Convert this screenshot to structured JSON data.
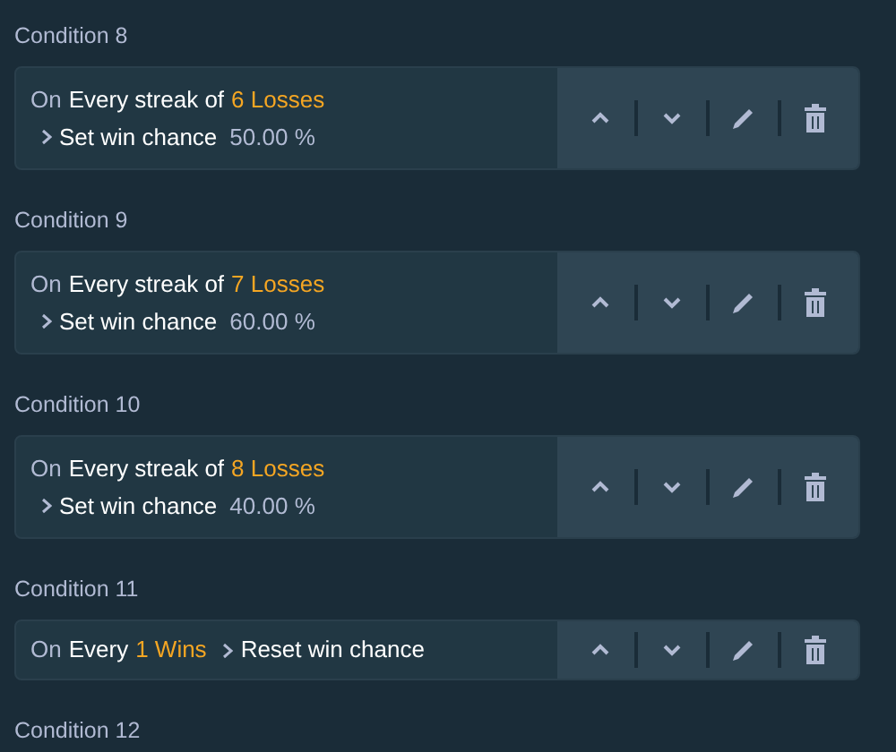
{
  "conditions": [
    {
      "title": "Condition 8",
      "kind": "stacked",
      "prefix": "On",
      "trigger": "Every streak of",
      "count": "6 Losses",
      "action": "Set win chance",
      "value": "50.00 %"
    },
    {
      "title": "Condition 9",
      "kind": "stacked",
      "prefix": "On",
      "trigger": "Every streak of",
      "count": "7 Losses",
      "action": "Set win chance",
      "value": "60.00 %"
    },
    {
      "title": "Condition 10",
      "kind": "stacked",
      "prefix": "On",
      "trigger": "Every streak of",
      "count": "8 Losses",
      "action": "Set win chance",
      "value": "40.00 %"
    },
    {
      "title": "Condition 11",
      "kind": "inline",
      "prefix": "On",
      "trigger": "Every",
      "count": "1 Wins",
      "action": "Reset win chance"
    },
    {
      "title": "Condition 12"
    }
  ]
}
